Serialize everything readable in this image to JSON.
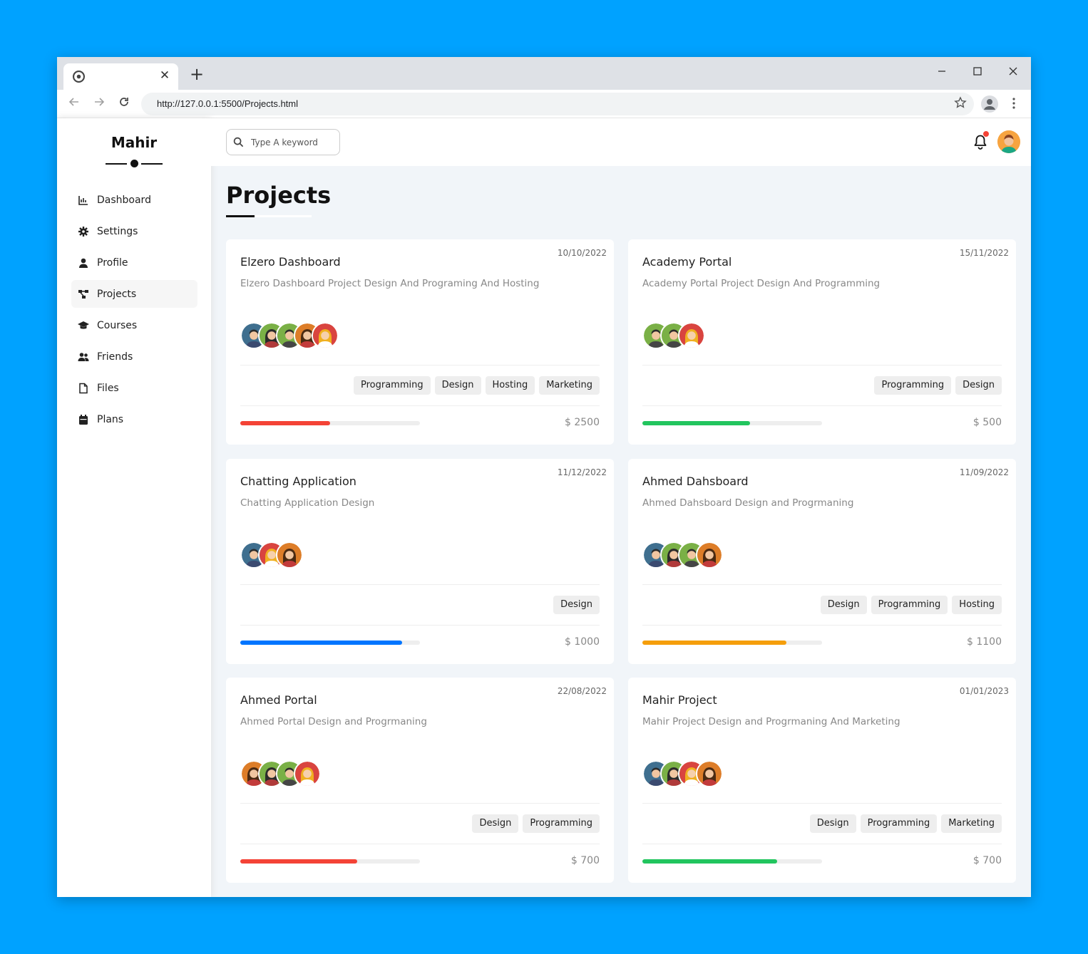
{
  "browser": {
    "url": "http://127.0.0.1:5500/Projects.html",
    "tab_close": "✕",
    "new_tab": "+"
  },
  "sidebar": {
    "brand": "Mahir",
    "items": [
      {
        "label": "Dashboard",
        "icon": "chart-icon"
      },
      {
        "label": "Settings",
        "icon": "gear-icon"
      },
      {
        "label": "Profile",
        "icon": "user-icon"
      },
      {
        "label": "Projects",
        "icon": "diagram-icon",
        "active": true
      },
      {
        "label": "Courses",
        "icon": "graduation-cap-icon"
      },
      {
        "label": "Friends",
        "icon": "users-icon"
      },
      {
        "label": "Files",
        "icon": "file-icon"
      },
      {
        "label": "Plans",
        "icon": "calendar-icon"
      }
    ]
  },
  "header": {
    "search_placeholder": "Type A keyword"
  },
  "page": {
    "title": "Projects"
  },
  "colors": {
    "accent_red": "#f44336",
    "accent_green": "#22c55e",
    "accent_blue": "#0075ff",
    "accent_orange": "#f59e0b"
  },
  "projects": [
    {
      "date": "10/10/2022",
      "title": "Elzero Dashboard",
      "desc": "Elzero Dashboard Project Design And Programing And Hosting",
      "team": [
        "man-blue",
        "woman-green",
        "man-green",
        "woman-orange",
        "woman-red"
      ],
      "tags": [
        "Programming",
        "Design",
        "Hosting",
        "Marketing"
      ],
      "progress": 0.5,
      "progress_color": "#f44336",
      "price": "$ 2500"
    },
    {
      "date": "15/11/2022",
      "title": "Academy Portal",
      "desc": "Academy Portal Project Design And Programming",
      "team": [
        "man-green",
        "man-green",
        "woman-red"
      ],
      "tags": [
        "Programming",
        "Design"
      ],
      "progress": 0.6,
      "progress_color": "#22c55e",
      "price": "$ 500"
    },
    {
      "date": "11/12/2022",
      "title": "Chatting Application",
      "desc": "Chatting Application Design",
      "team": [
        "man-blue",
        "woman-red",
        "woman-orange"
      ],
      "tags": [
        "Design"
      ],
      "progress": 0.9,
      "progress_color": "#0075ff",
      "price": "$ 1000"
    },
    {
      "date": "11/09/2022",
      "title": "Ahmed Dahsboard",
      "desc": "Ahmed Dahsboard Design and Progrmaning",
      "team": [
        "man-blue",
        "woman-green",
        "man-green",
        "woman-orange"
      ],
      "tags": [
        "Design",
        "Programming",
        "Hosting"
      ],
      "progress": 0.8,
      "progress_color": "#f59e0b",
      "price": "$ 1100"
    },
    {
      "date": "22/08/2022",
      "title": "Ahmed Portal",
      "desc": "Ahmed Portal Design and Progrmaning",
      "team": [
        "woman-orange",
        "woman-green",
        "man-green",
        "woman-red"
      ],
      "tags": [
        "Design",
        "Programming"
      ],
      "progress": 0.65,
      "progress_color": "#f44336",
      "price": "$ 700"
    },
    {
      "date": "01/01/2023",
      "title": "Mahir Project",
      "desc": "Mahir Project Design and Progrmaning And Marketing",
      "team": [
        "man-blue",
        "woman-green",
        "woman-red",
        "woman-orange"
      ],
      "tags": [
        "Design",
        "Programming",
        "Marketing"
      ],
      "progress": 0.75,
      "progress_color": "#22c55e",
      "price": "$ 700"
    }
  ]
}
